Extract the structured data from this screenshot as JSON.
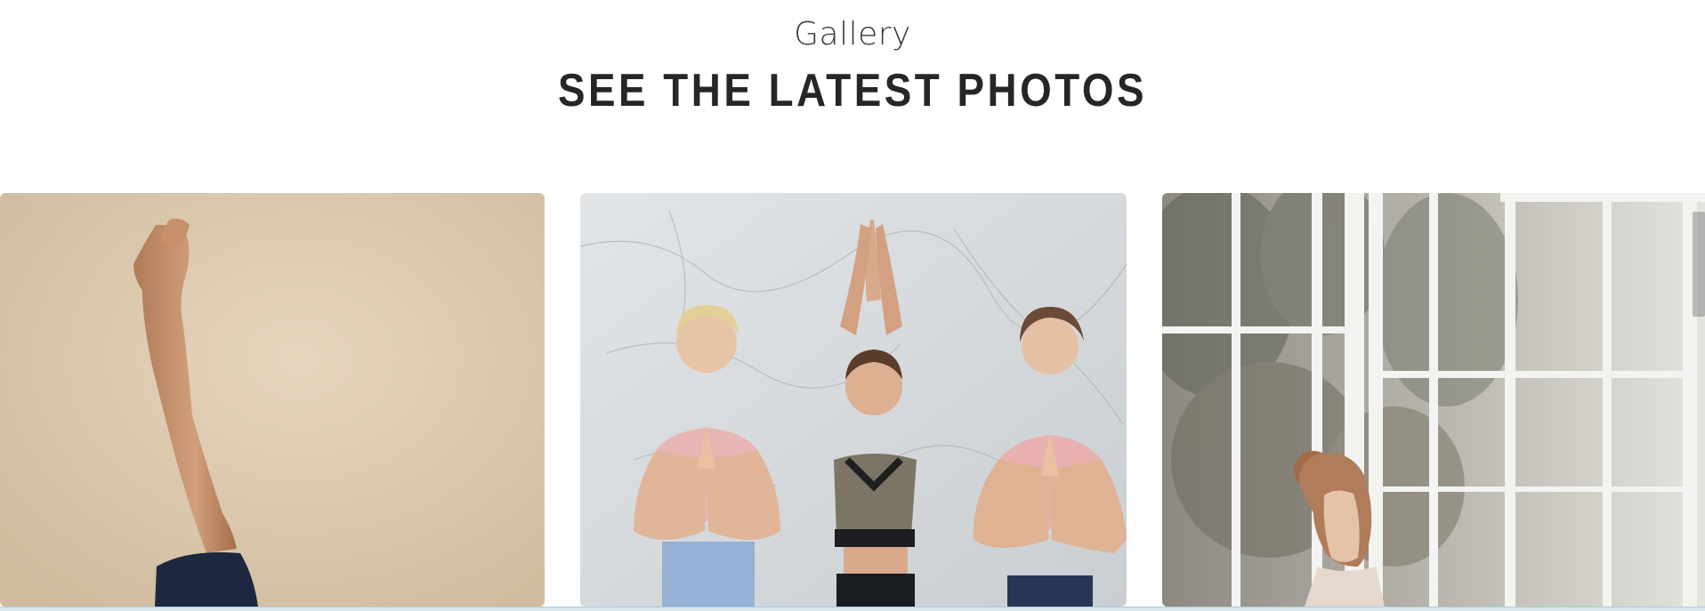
{
  "section": {
    "eyebrow": "Gallery",
    "title": "SEE THE LATEST PHOTOS"
  },
  "gallery": {
    "photos": [
      {
        "subject": "raised-leg-yoga-pose"
      },
      {
        "subject": "three-women-prayer-pose"
      },
      {
        "subject": "woman-by-window"
      }
    ]
  },
  "colors": {
    "headline": "#262626",
    "eyebrow": "#3a3a3a",
    "photo1_wall": "#dcc9ad",
    "photo2_wall": "#d9dde0",
    "photo3_window": "#d7d5cf",
    "bottom_strip": "#dbe8ee"
  }
}
